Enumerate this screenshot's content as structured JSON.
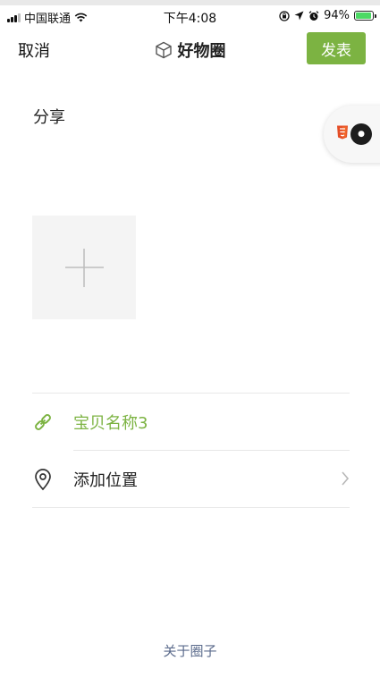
{
  "status_bar": {
    "carrier": "中国联通",
    "time": "下午4:08",
    "battery_percent": "94%",
    "battery_level": 0.94,
    "icons": [
      "signal-icon",
      "wifi-icon",
      "screen-lock-icon",
      "location-arrow-icon",
      "alarm-icon",
      "battery-icon"
    ]
  },
  "nav": {
    "cancel_label": "取消",
    "title": "好物圈",
    "title_icon": "cube-icon",
    "publish_label": "发表",
    "accent_color": "#7cb342"
  },
  "compose": {
    "share_label": "分享",
    "add_image_icon": "plus-icon"
  },
  "floating_badge": {
    "icons": [
      "html5-icon",
      "avatar-icon"
    ]
  },
  "rows": {
    "product": {
      "label": "宝贝名称3",
      "icon": "link-icon",
      "color": "#7cb342"
    },
    "location": {
      "label": "添加位置",
      "icon": "location-pin-icon"
    }
  },
  "footer": {
    "about_label": "关于圈子",
    "color": "#5b6b8c"
  }
}
